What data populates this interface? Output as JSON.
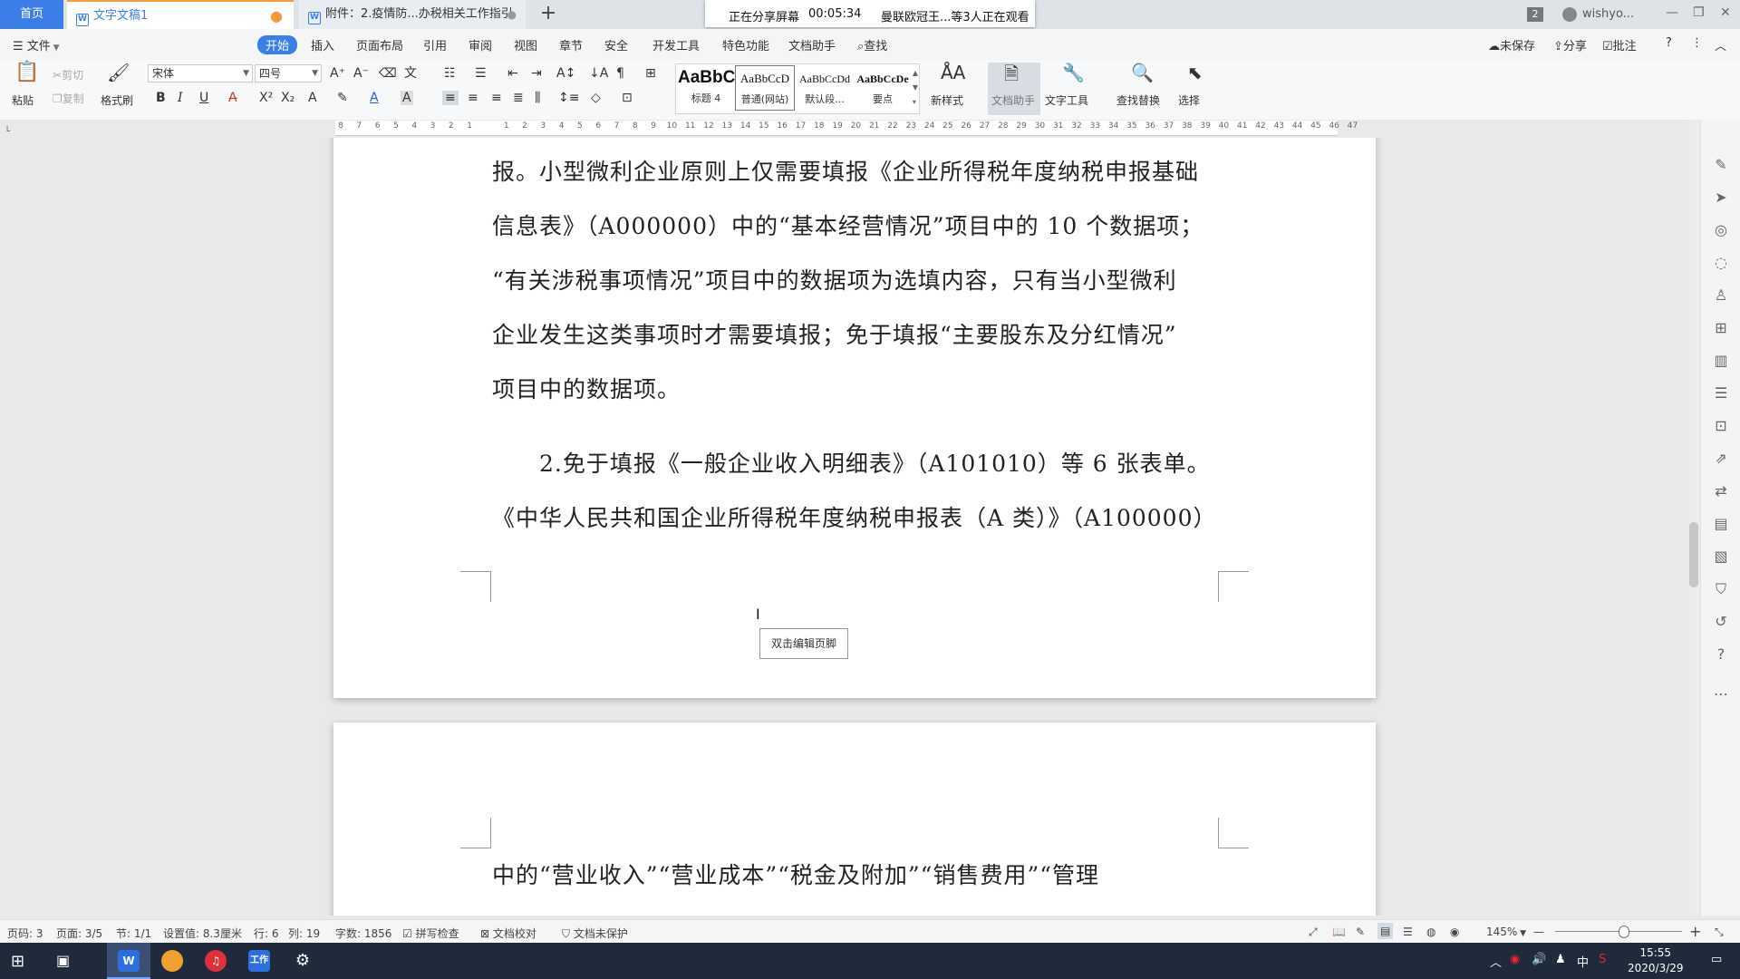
{
  "tabs": {
    "home": "首页",
    "doc1": "文字文稿1",
    "doc2": "附件：2.疫情防...办税相关工作指引",
    "add": "+"
  },
  "share_banner": {
    "status": "正在分享屏幕",
    "timer": "00:05:34",
    "viewers": "曼联欧冠王...等3人正在观看"
  },
  "window": {
    "badge": "2",
    "user": "wishyo...",
    "minimize": "—",
    "maximize": "❐",
    "close": "✕"
  },
  "menu": {
    "file": "文件",
    "start": "开始",
    "insert": "插入",
    "layout": "页面布局",
    "reference": "引用",
    "review": "审阅",
    "view": "视图",
    "chapter": "章节",
    "security": "安全",
    "devtools": "开发工具",
    "special": "特色功能",
    "assistant": "文档助手",
    "find": "查找",
    "unsaved": "未保存",
    "share": "分享",
    "comment": "批注",
    "help": "?"
  },
  "ribbon": {
    "paste": "粘贴",
    "cut": "剪切",
    "copy": "复制",
    "format_painter": "格式刷",
    "font_name": "宋体",
    "font_size": "四号",
    "bold": "B",
    "italic": "I",
    "underline": "U",
    "styles": [
      {
        "preview": "AaBbC",
        "name": "标题 4"
      },
      {
        "preview": "AaBbCcD",
        "name": "普通(网站)"
      },
      {
        "preview": "AaBbCcDd",
        "name": "默认段..."
      },
      {
        "preview": "AaBbCcDe",
        "name": "要点"
      }
    ],
    "new_style": "新样式",
    "doc_assistant": "文档助手",
    "text_tools": "文字工具",
    "find_replace": "查找替换",
    "select": "选择"
  },
  "ruler": {
    "ticks": [
      "8",
      "7",
      "6",
      "5",
      "4",
      "3",
      "2",
      "1",
      "",
      "1",
      "2",
      "3",
      "4",
      "5",
      "6",
      "7",
      "8",
      "9",
      "10",
      "11",
      "12",
      "13",
      "14",
      "15",
      "16",
      "17",
      "18",
      "19",
      "20",
      "21",
      "22",
      "23",
      "24",
      "25",
      "26",
      "27",
      "28",
      "29",
      "30",
      "31",
      "32",
      "33",
      "34",
      "35",
      "36",
      "37",
      "38",
      "39",
      "40",
      "41",
      "42",
      "43",
      "44",
      "45",
      "46",
      "47"
    ]
  },
  "document": {
    "lines": [
      "报。小型微利企业原则上仅需要填报《企业所得税年度纳税申报基础",
      "信息表》（A000000）中的“基本经营情况”项目中的 10 个数据项；",
      "“有关涉税事项情况”项目中的数据项为选填内容，只有当小型微利",
      "企业发生这类事项时才需要填报；免于填报“主要股东及分红情况”",
      "项目中的数据项。",
      "2.免于填报《一般企业收入明细表》（A101010）等 6 张表单。",
      "《中华人民共和国企业所得税年度纳税申报表（A 类）》（A100000）",
      "中的“营业收入”“营业成本”“税金及附加”“销售费用”“管理"
    ],
    "footer_hint": "双击编辑页脚"
  },
  "status": {
    "page_num": "页码: 3",
    "pages": "页面: 3/5",
    "section": "节: 1/1",
    "position": "设置值: 8.3厘米",
    "row": "行: 6",
    "col": "列: 19",
    "words": "字数: 1856",
    "spellcheck": "拼写检查",
    "proofread": "文档校对",
    "protect": "文档未保护",
    "zoom": "145%"
  },
  "taskbar": {
    "app_wps": "W",
    "app_work": "工作",
    "clock_time": "15:55",
    "clock_date": "2020/3/29",
    "ime": "中"
  }
}
